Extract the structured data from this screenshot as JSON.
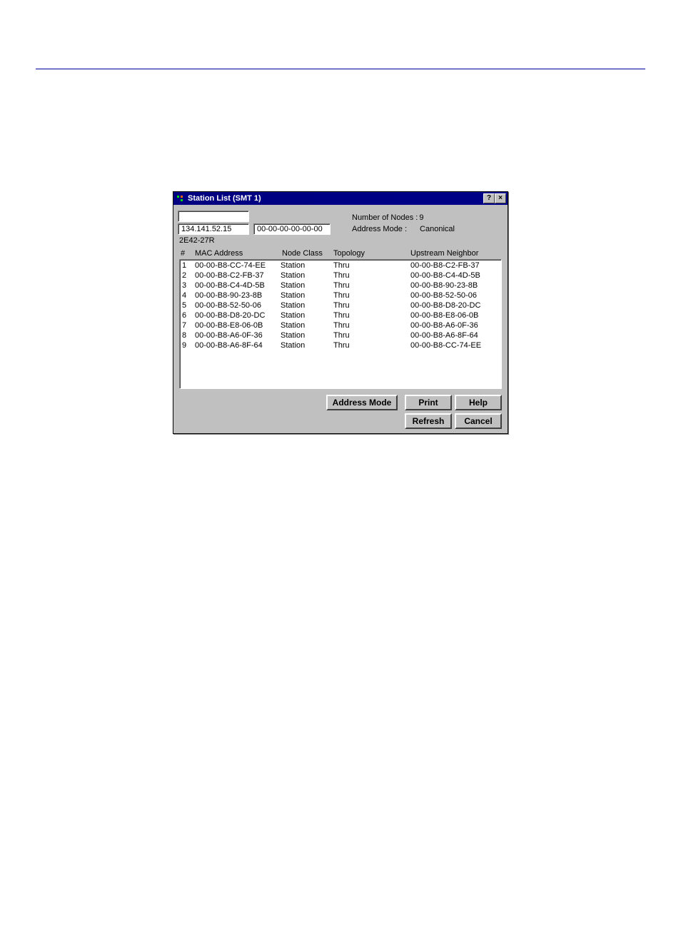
{
  "window": {
    "title": "Station List (SMT 1)"
  },
  "captions": {
    "help": "?",
    "close": "×"
  },
  "fields": {
    "ip": "134.141.52.15",
    "mac": "00-00-00-00-00-00",
    "device": "2E42-27R"
  },
  "info": {
    "nodes_label": "Number of Nodes :",
    "nodes_value": "9",
    "mode_label": "Address Mode :",
    "mode_value": "Canonical"
  },
  "columns": {
    "num": "#",
    "mac": "MAC Address",
    "class": "Node Class",
    "topology": "Topology",
    "neighbor": "Upstream Neighbor"
  },
  "rows": [
    {
      "n": "1",
      "mac": "00-00-B8-CC-74-EE",
      "cls": "Station",
      "topo": "Thru",
      "up": "00-00-B8-C2-FB-37"
    },
    {
      "n": "2",
      "mac": "00-00-B8-C2-FB-37",
      "cls": "Station",
      "topo": "Thru",
      "up": "00-00-B8-C4-4D-5B"
    },
    {
      "n": "3",
      "mac": "00-00-B8-C4-4D-5B",
      "cls": "Station",
      "topo": "Thru",
      "up": "00-00-B8-90-23-8B"
    },
    {
      "n": "4",
      "mac": "00-00-B8-90-23-8B",
      "cls": "Station",
      "topo": "Thru",
      "up": "00-00-B8-52-50-06"
    },
    {
      "n": "5",
      "mac": "00-00-B8-52-50-06",
      "cls": "Station",
      "topo": "Thru",
      "up": "00-00-B8-D8-20-DC"
    },
    {
      "n": "6",
      "mac": "00-00-B8-D8-20-DC",
      "cls": "Station",
      "topo": "Thru",
      "up": "00-00-B8-E8-06-0B"
    },
    {
      "n": "7",
      "mac": "00-00-B8-E8-06-0B",
      "cls": "Station",
      "topo": "Thru",
      "up": "00-00-B8-A6-0F-36"
    },
    {
      "n": "8",
      "mac": "00-00-B8-A6-0F-36",
      "cls": "Station",
      "topo": "Thru",
      "up": "00-00-B8-A6-8F-64"
    },
    {
      "n": "9",
      "mac": "00-00-B8-A6-8F-64",
      "cls": "Station",
      "topo": "Thru",
      "up": "00-00-B8-CC-74-EE"
    }
  ],
  "buttons": {
    "address_mode": "Address Mode",
    "print": "Print",
    "help": "Help",
    "refresh": "Refresh",
    "cancel": "Cancel"
  }
}
